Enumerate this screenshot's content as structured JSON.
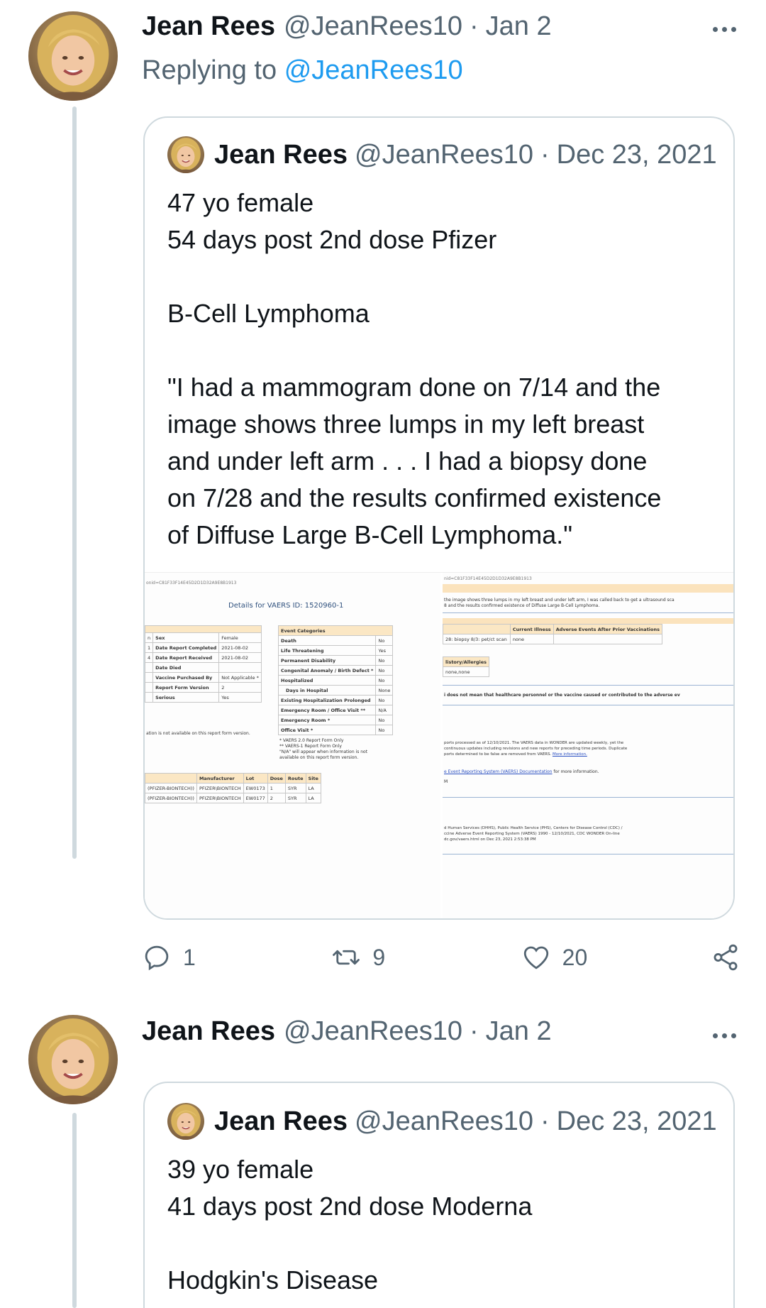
{
  "tweets": [
    {
      "author_name": "Jean Rees",
      "handle": "@JeanRees10",
      "separator": "·",
      "date": "Jan 2",
      "replying_prefix": "Replying to",
      "replying_to": "@JeanRees10",
      "quote": {
        "author_name": "Jean Rees",
        "handle": "@JeanRees10",
        "separator": "·",
        "date": "Dec 23, 2021",
        "lines": [
          "47 yo female",
          "54 days post 2nd dose Pfizer",
          "",
          "B-Cell Lymphoma",
          "",
          "\"I had a mammogram done on 7/14 and the",
          "image shows three lumps in my left breast",
          "and under left arm . . . I had a biopsy done",
          "on 7/28 and the results confirmed existence",
          "of Diffuse Large B-Cell Lymphoma.\""
        ],
        "media": {
          "left": {
            "url_fragment": "onid=C81F33F14E45D2D1D32A9E8B1913",
            "heading": "Details for VAERS ID: 1520960-1",
            "demographics": [
              [
                "n",
                "Sex",
                "Female"
              ],
              [
                "1",
                "Date Report Completed",
                "2021-08-02"
              ],
              [
                "4",
                "Date Report Received",
                "2021-08-02"
              ],
              [
                "",
                "Date Died",
                ""
              ],
              [
                "",
                "Vaccine Purchased By",
                "Not Applicable *"
              ],
              [
                "",
                "Report Form Version",
                "2"
              ],
              [
                "",
                "Serious",
                "Yes"
              ]
            ],
            "event_header": "Event Categories",
            "events": [
              [
                "Death",
                "No"
              ],
              [
                "Life Threatening",
                "Yes"
              ],
              [
                "Permanent Disability",
                "No"
              ],
              [
                "Congenital Anomaly / Birth Defect *",
                "No"
              ],
              [
                "Hospitalized",
                "No"
              ],
              [
                "Days in Hospital",
                "None"
              ],
              [
                "Existing Hospitalization Prolonged",
                "No"
              ],
              [
                "Emergency Room / Office Visit **",
                "N/A"
              ],
              [
                "Emergency Room *",
                "No"
              ],
              [
                "Office Visit *",
                "No"
              ]
            ],
            "notes": [
              "* VAERS 2.0 Report Form Only",
              "** VAERS-1 Report Form Only",
              "\"N/A\" will appear when information is not",
              "available on this report form version."
            ],
            "not_available_note": "ation is not available on this report form version.",
            "vax_headers": [
              "Manufacturer",
              "Lot",
              "Dose",
              "Route",
              "Site"
            ],
            "vax_rows": [
              [
                "(PFIZER-BIONTECH))",
                "PFIZER\\BIONTECH",
                "EW0173",
                "1",
                "SYR",
                "LA"
              ],
              [
                "(PFIZER-BIONTECH))",
                "PFIZER\\BIONTECH",
                "EW0177",
                "2",
                "SYR",
                "LA"
              ]
            ]
          },
          "right": {
            "url_fragment": "nid=C81F33F14E45D2D1D32A9E8B1913",
            "symptom_text_1": "the image shows three lumps in my left breast and under left arm, I was called back to get a ultrasound sca",
            "symptom_text_2": "8 and the results confirmed existence of Diffuse Large B-Cell Lymphoma.",
            "col_headers": [
              "Current Illness",
              "Adverse Events After Prior Vaccinations"
            ],
            "lab_text": "28: biopsy 8/3: pet/ct scan",
            "current_illness": "none",
            "history_header": "listory/Allergies",
            "history_value": "none,none",
            "disclaimer": "i does not mean that healthcare personnel or the vaccine caused or contributed to the adverse ev",
            "processed_1": "ports processed as of 12/10/2021. The VAERS data in WONDER are updated weekly, yet the",
            "processed_2": "continuous updates including revisions and new reports for preceding time periods. Duplicate",
            "processed_3": "ports determined to be false are removed from VAERS.",
            "more_info": "More information.",
            "doc_link": "e Event Reporting System (VAERS) Documentation",
            "doc_suffix": " for more information.",
            "pm": "M",
            "citation_1": "d Human Services (DHHS), Public Health Service (PHS), Centers for Disease Control (CDC) /",
            "citation_2": "ccine Adverse Event Reporting System (VAERS) 1990 - 12/10/2021, CDC WONDER On-line",
            "citation_3": "dc.gov/vaers.html on Dec 23, 2021 2:53:38 PM"
          }
        }
      },
      "actions": {
        "replies": "1",
        "retweets": "9",
        "likes": "20"
      }
    },
    {
      "author_name": "Jean Rees",
      "handle": "@JeanRees10",
      "separator": "·",
      "date": "Jan 2",
      "quote": {
        "author_name": "Jean Rees",
        "handle": "@JeanRees10",
        "separator": "·",
        "date": "Dec 23, 2021",
        "lines": [
          "39 yo female",
          "41 days post 2nd dose Moderna",
          "",
          "Hodgkin's Disease"
        ]
      }
    }
  ],
  "colors": {
    "text": "#0f1419",
    "secondary": "#536471",
    "link": "#1d9bf0",
    "border": "#cfd9de"
  },
  "icons": [
    "more-icon",
    "reply-icon",
    "retweet-icon",
    "like-icon",
    "share-icon"
  ]
}
